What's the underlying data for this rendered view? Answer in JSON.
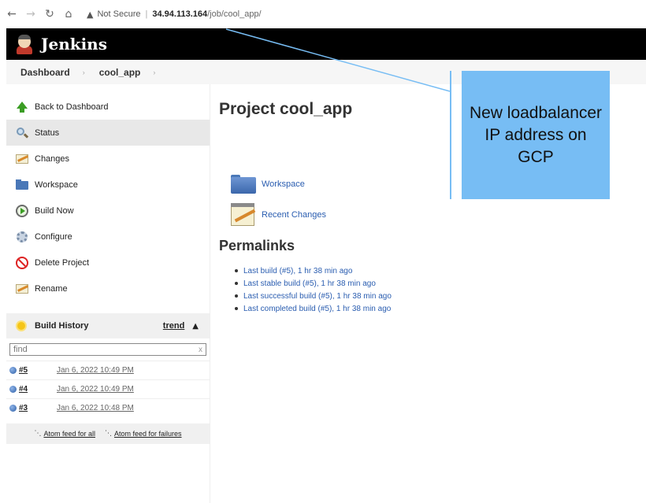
{
  "browser": {
    "security_label": "Not Secure",
    "url_host": "34.94.113.164",
    "url_path": "/job/cool_app/"
  },
  "header": {
    "title": "Jenkins"
  },
  "breadcrumb": {
    "items": [
      "Dashboard",
      "cool_app"
    ]
  },
  "sidebar": {
    "items": [
      {
        "label": "Back to Dashboard",
        "icon": "up-arrow-icon"
      },
      {
        "label": "Status",
        "icon": "search-icon",
        "active": true
      },
      {
        "label": "Changes",
        "icon": "notepad-icon"
      },
      {
        "label": "Workspace",
        "icon": "folder-icon"
      },
      {
        "label": "Build Now",
        "icon": "clock-icon"
      },
      {
        "label": "Configure",
        "icon": "gear-icon"
      },
      {
        "label": "Delete Project",
        "icon": "no-entry-icon"
      },
      {
        "label": "Rename",
        "icon": "notepad-icon"
      }
    ]
  },
  "build_history": {
    "title": "Build History",
    "trend_label": "trend",
    "filter_placeholder": "find",
    "clear_label": "x",
    "builds": [
      {
        "number": "#5",
        "date": "Jan 6, 2022 10:49 PM"
      },
      {
        "number": "#4",
        "date": "Jan 6, 2022 10:49 PM"
      },
      {
        "number": "#3",
        "date": "Jan 6, 2022 10:48 PM"
      }
    ],
    "feed_all": "Atom feed for all",
    "feed_failures": "Atom feed for failures"
  },
  "main": {
    "title": "Project cool_app",
    "workspace_link": "Workspace",
    "recent_changes_link": "Recent Changes",
    "permalinks_title": "Permalinks",
    "permalinks": [
      "Last build (#5), 1 hr 38 min ago",
      "Last stable build (#5), 1 hr 38 min ago",
      "Last successful build (#5), 1 hr 38 min ago",
      "Last completed build (#5), 1 hr 38 min ago"
    ]
  },
  "annotation": {
    "text": "New loadbalancer IP address on GCP",
    "color": "#77bdf4"
  }
}
